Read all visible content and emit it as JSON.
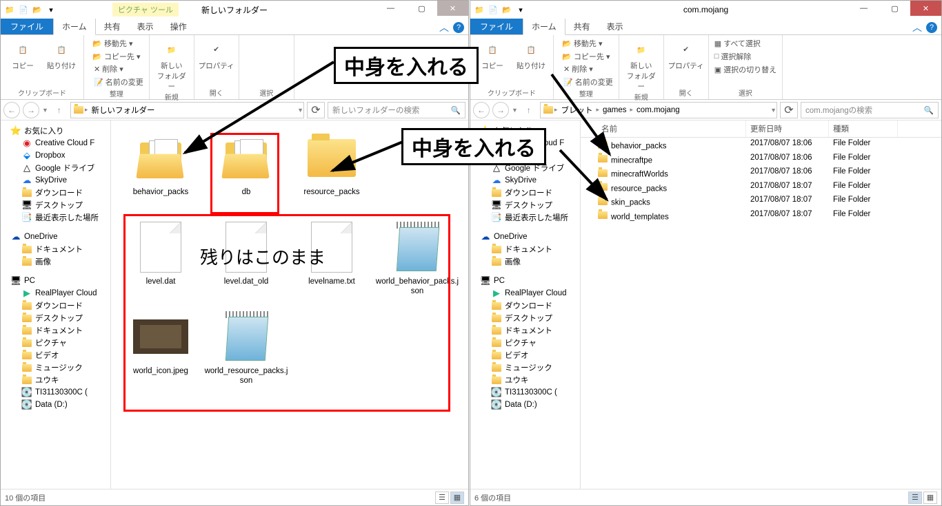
{
  "left": {
    "title": "新しいフォルダー",
    "tool_tab": "ピクチャ ツール",
    "tabs": {
      "file": "ファイル",
      "home": "ホーム",
      "share": "共有",
      "view": "表示",
      "op": "操作"
    },
    "ribbon": {
      "clipboard": {
        "copy": "コピー",
        "paste": "貼り付け",
        "group": "クリップボード"
      },
      "organize": {
        "moveto": "移動先",
        "copyto": "コピー先",
        "delete": "削除",
        "rename": "名前の変更",
        "group": "整理"
      },
      "new": {
        "newfolder": "新しい\nフォルダー",
        "group": "新規"
      },
      "open": {
        "props": "プロパティ",
        "group": "開く"
      },
      "select": {
        "group": "選択"
      }
    },
    "breadcrumb": [
      "新しいフォルダー"
    ],
    "search_placeholder": "新しいフォルダーの検索",
    "tree": {
      "fav": "お気に入り",
      "cc": "Creative Cloud F",
      "dropbox": "Dropbox",
      "gdrive": "Google ドライブ",
      "skydrive": "SkyDrive",
      "dl": "ダウンロード",
      "desktop": "デスクトップ",
      "recent": "最近表示した場所",
      "onedrive": "OneDrive",
      "docs": "ドキュメント",
      "pics": "画像",
      "pc": "PC",
      "rp": "RealPlayer Cloud",
      "dl2": "ダウンロード",
      "desktop2": "デスクトップ",
      "docs2": "ドキュメント",
      "pics2": "ピクチャ",
      "vids": "ビデオ",
      "music": "ミュージック",
      "yuuki": "ユウキ",
      "ti": "TI31130300C (",
      "datad": "Data (D:)"
    },
    "files": [
      {
        "name": "behavior_packs",
        "type": "folder-docs"
      },
      {
        "name": "db",
        "type": "folder-docs"
      },
      {
        "name": "resource_packs",
        "type": "folder"
      },
      {
        "name": "level.dat",
        "type": "file"
      },
      {
        "name": "level.dat_old",
        "type": "file"
      },
      {
        "name": "levelname.txt",
        "type": "file"
      },
      {
        "name": "world_behavior_packs.json",
        "type": "notepad"
      },
      {
        "name": "world_icon.jpeg",
        "type": "image"
      },
      {
        "name": "world_resource_packs.json",
        "type": "notepad"
      }
    ],
    "status": "10 個の項目"
  },
  "right": {
    "title": "com.mojang",
    "tabs": {
      "file": "ファイル",
      "home": "ホーム",
      "share": "共有",
      "view": "表示"
    },
    "ribbon": {
      "clipboard": {
        "copy": "コピー",
        "paste": "貼り付け",
        "group": "クリップボード"
      },
      "organize": {
        "moveto": "移動先",
        "copyto": "コピー先",
        "delete": "削除",
        "rename": "名前の変更",
        "group": "整理"
      },
      "new": {
        "newfolder": "新しい\nフォルダー",
        "group": "新規"
      },
      "open": {
        "props": "プロパティ",
        "group": "開く"
      },
      "select": {
        "all": "すべて選択",
        "none": "選択解除",
        "inv": "選択の切り替え",
        "group": "選択"
      }
    },
    "breadcrumb": [
      "ブレット",
      "games",
      "com.mojang"
    ],
    "search_placeholder": "com.mojangの検索",
    "list_head": {
      "name": "名前",
      "date": "更新日時",
      "type": "種類"
    },
    "rows": [
      {
        "name": "behavior_packs",
        "date": "2017/08/07 18:06",
        "type": "File Folder"
      },
      {
        "name": "minecraftpe",
        "date": "2017/08/07 18:06",
        "type": "File Folder"
      },
      {
        "name": "minecraftWorlds",
        "date": "2017/08/07 18:06",
        "type": "File Folder"
      },
      {
        "name": "resource_packs",
        "date": "2017/08/07 18:07",
        "type": "File Folder"
      },
      {
        "name": "skin_packs",
        "date": "2017/08/07 18:07",
        "type": "File Folder"
      },
      {
        "name": "world_templates",
        "date": "2017/08/07 18:07",
        "type": "File Folder"
      }
    ],
    "status": "6 個の項目"
  },
  "annotations": {
    "top": "中身を入れる",
    "mid": "中身を入れる",
    "remain": "残りはこのまま"
  }
}
